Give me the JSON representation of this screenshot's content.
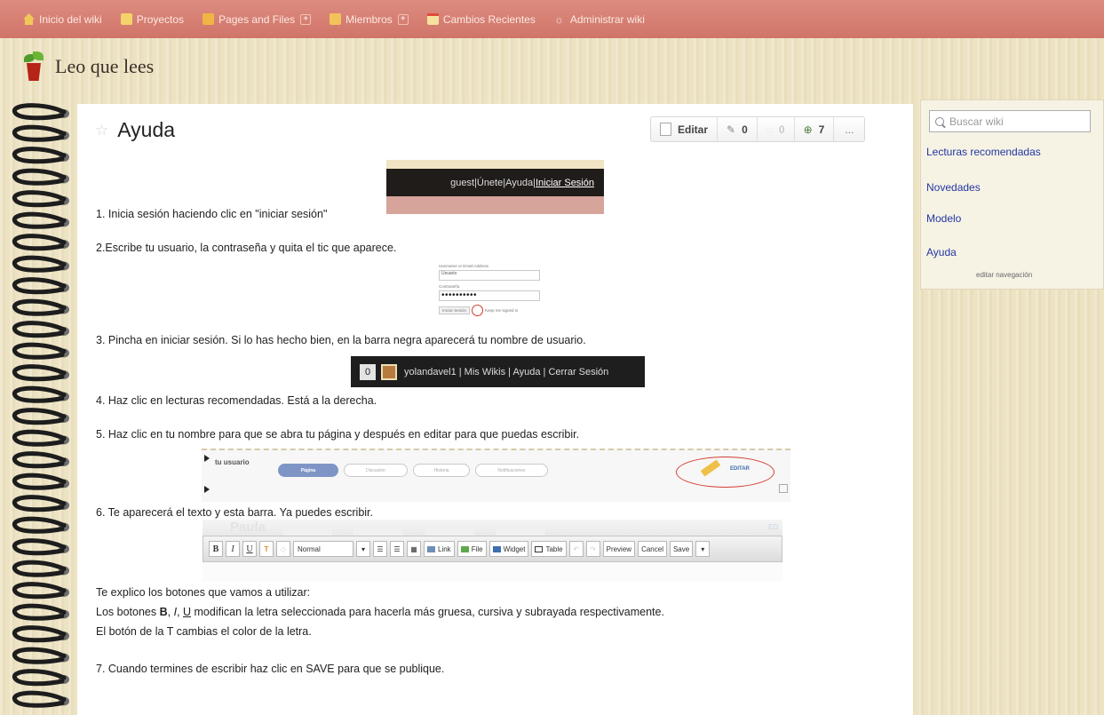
{
  "nav": {
    "items": [
      {
        "label": "Inicio del wiki",
        "icon": "home-icon"
      },
      {
        "label": "Proyectos",
        "icon": "projects-icon"
      },
      {
        "label": "Pages and Files",
        "icon": "pages-icon",
        "plus": true
      },
      {
        "label": "Miembros",
        "icon": "members-icon",
        "plus": true
      },
      {
        "label": "Cambios Recientes",
        "icon": "calendar-icon"
      },
      {
        "label": "Administrar wiki",
        "icon": "gear-icon"
      }
    ],
    "plus_glyph": "+"
  },
  "site": {
    "title": "Leo que lees",
    "logo": "plant-pot-logo"
  },
  "page": {
    "title": "Ayuda",
    "toolbar": {
      "edit": "Editar",
      "comments": "0",
      "follow": "0",
      "links": "7",
      "more": "..."
    }
  },
  "steps": {
    "s1": "1. Inicia sesión haciendo clic en \"iniciar sesión\"",
    "s2": "2.Escribe tu usuario, la contraseña y quita el tic que aparece.",
    "s3": "3. Pincha en iniciar sesión. Si lo has hecho bien, en la barra negra aparecerá tu nombre de usuario.",
    "s4": "4. Haz clic en lecturas recomendadas. Está a la derecha.",
    "s5": "5. Haz clic en tu nombre para que se abra tu página y después en editar para que puedas escribir.",
    "s6": "6. Te aparecerá el texto y esta barra. Ya puedes escribir.",
    "explain_intro": "Te explico los botones que vamos a utilizar:",
    "explain_1_pre": "Los botones ",
    "explain_1_b": "B",
    "explain_1_sep1": ", ",
    "explain_1_i": "I",
    "explain_1_sep2": ", ",
    "explain_1_u": "U",
    "explain_1_post": " modifican la letra seleccionada para hacerla más gruesa, cursiva y subrayada respectivamente.",
    "explain_2": "El botón de la T cambias el color de la letra.",
    "s7": "7. Cuando termines de escribir haz clic en SAVE para que se publique."
  },
  "shot_login_bar": {
    "user": "guest",
    "join": "Únete",
    "help": "Ayuda",
    "login": "Iniciar Sesión",
    "sep": " | "
  },
  "shot_login_form": {
    "user_label": "Username or Email Address",
    "user_value": "Usuario",
    "pass_label": "Contraseña",
    "pass_value": "••••••••••",
    "button": "Iniciar Sesión",
    "remember": "Keep me signed in"
  },
  "shot_user_bar": {
    "badge": "0",
    "text": "yolandavel1 | Mis Wikis | Ayuda | Cerrar Sesión"
  },
  "shot_user_page": {
    "label": "tu usuario",
    "tabs": [
      "Página",
      "Discusión",
      "Historia",
      "Notificaciones"
    ],
    "edit": "EDITAR"
  },
  "shot_editor": {
    "ghost_title": "Paula",
    "bold": "B",
    "italic": "I",
    "underline": "U",
    "color": "T",
    "format": "Normal",
    "link": "Link",
    "file": "File",
    "widget": "Widget",
    "table": "Table",
    "preview": "Preview",
    "cancel": "Cancel",
    "save": "Save",
    "dropdown": "▾",
    "ed_fragment": "ED"
  },
  "sidebar": {
    "search_placeholder": "Buscar wiki",
    "links": [
      "Lecturas recomendadas",
      "Novedades",
      "Modelo",
      "Ayuda"
    ],
    "edit_nav": "editar navegación"
  },
  "colors": {
    "nav_bg": "#d07468",
    "link": "#2336a3",
    "page_bg": "#ede3c3"
  }
}
